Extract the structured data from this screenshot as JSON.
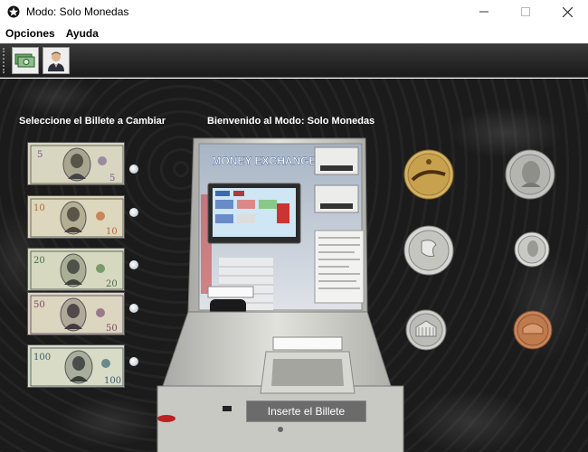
{
  "window": {
    "title": "Modo: Solo Monedas",
    "controls": [
      "minimize",
      "maximize",
      "close"
    ]
  },
  "menu": {
    "items": [
      {
        "label": "Opciones"
      },
      {
        "label": "Ayuda"
      }
    ]
  },
  "toolbar": {
    "buttons": [
      {
        "icon": "money-icon"
      },
      {
        "icon": "user-icon"
      }
    ]
  },
  "main": {
    "left_heading": "Seleccione el Billete a Cambiar",
    "center_heading": "Bienvenido al  Modo: Solo Monedas",
    "bills": [
      {
        "value": "5"
      },
      {
        "value": "10"
      },
      {
        "value": "20"
      },
      {
        "value": "50"
      },
      {
        "value": "100"
      }
    ],
    "machine": {
      "sign": "MONEY EXCHANGE",
      "insert_button": "Inserte el Billete"
    },
    "coins": [
      {
        "name": "dollar-gold",
        "color": "#c9a24a"
      },
      {
        "name": "dollar-silver",
        "color": "#b8b8b8"
      },
      {
        "name": "quarter",
        "color": "#c8c8c8"
      },
      {
        "name": "dime",
        "color": "#cfcfcf"
      },
      {
        "name": "nickel",
        "color": "#c2c2c2"
      },
      {
        "name": "penny",
        "color": "#c07a55"
      }
    ]
  }
}
